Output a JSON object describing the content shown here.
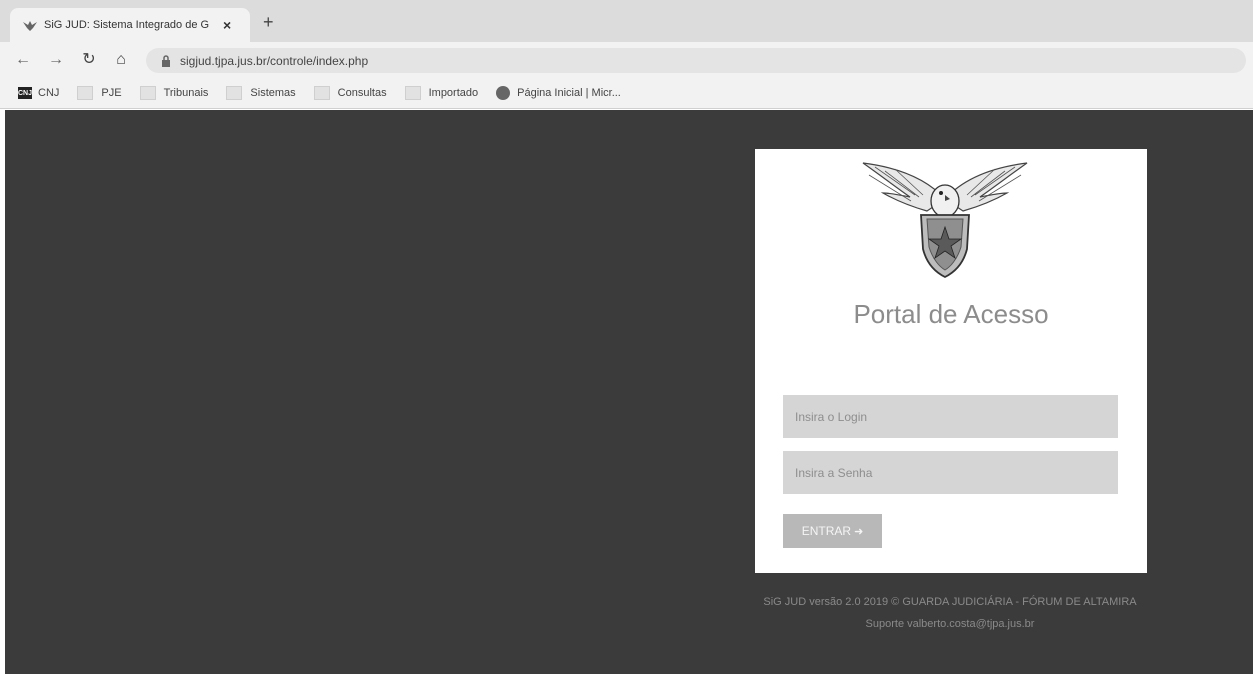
{
  "browser": {
    "tab_title": "SiG JUD: Sistema Integrado de G",
    "tab_close": "×",
    "new_tab": "+",
    "url": "sigjud.tjpa.jus.br/controle/index.php",
    "nav": {
      "back": "←",
      "forward": "→",
      "reload": "↻",
      "home": "⌂"
    }
  },
  "bookmarks": [
    {
      "label": "CNJ",
      "icon": "cnj-icon"
    },
    {
      "label": "PJE",
      "icon": "folder-icon"
    },
    {
      "label": "Tribunais",
      "icon": "folder-icon"
    },
    {
      "label": "Sistemas",
      "icon": "folder-icon"
    },
    {
      "label": "Consultas",
      "icon": "folder-icon"
    },
    {
      "label": "Importado",
      "icon": "folder-icon"
    },
    {
      "label": "Página Inicial | Micr...",
      "icon": "office-icon"
    }
  ],
  "login": {
    "title": "Portal de Acesso",
    "login_placeholder": "Insira o Login",
    "password_placeholder": "Insira a Senha",
    "submit_label": "ENTRAR",
    "submit_icon": "➜"
  },
  "footer": {
    "line1": "SiG JUD versão 2.0 2019 © GUARDA JUDICIÁRIA - FÓRUM DE ALTAMIRA",
    "line2": "Suporte valberto.costa@tjpa.jus.br"
  },
  "colors": {
    "background": "#3b3b3b",
    "card": "#ffffff",
    "input": "#d5d5d5",
    "button": "#b8b8b8"
  }
}
